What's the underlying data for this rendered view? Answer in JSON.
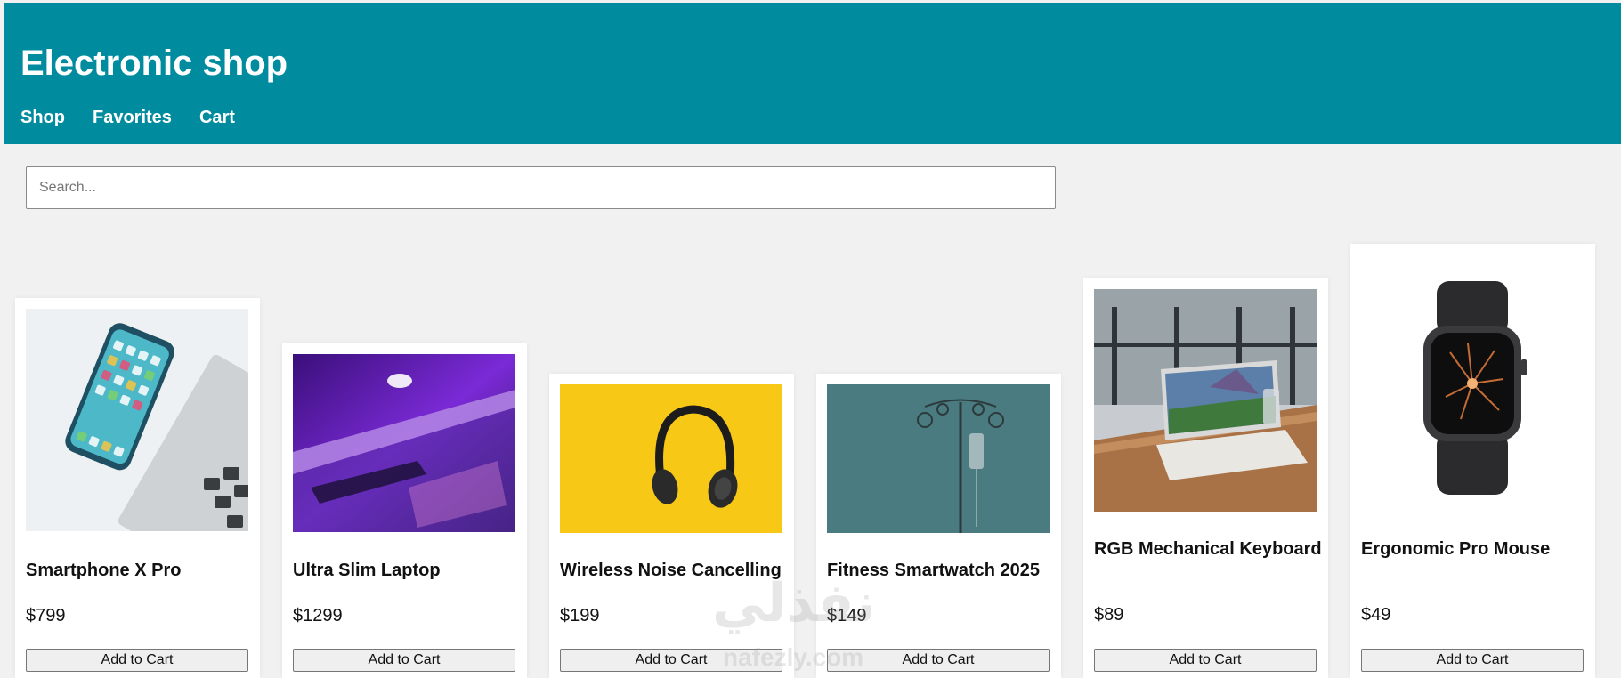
{
  "header": {
    "title": "Electronic shop",
    "nav": [
      "Shop",
      "Favorites",
      "Cart"
    ]
  },
  "search": {
    "placeholder": "Search...",
    "value": ""
  },
  "products": [
    {
      "name": "Smartphone X Pro",
      "price": "$799",
      "button": "Add to Cart",
      "image": "smartphone-photo"
    },
    {
      "name": "Ultra Slim Laptop",
      "price": "$1299",
      "button": "Add to Cart",
      "image": "laptop-photo"
    },
    {
      "name": "Wireless Noise Cancelling",
      "price": "$199",
      "button": "Add to Cart",
      "image": "headphones-photo"
    },
    {
      "name": "Fitness Smartwatch 2025",
      "price": "$149",
      "button": "Add to Cart",
      "image": "iv-stand-photo"
    },
    {
      "name": "RGB Mechanical Keyboard",
      "price": "$89",
      "button": "Add to Cart",
      "image": "laptop-desk-photo"
    },
    {
      "name": "Ergonomic Pro Mouse",
      "price": "$49",
      "button": "Add to Cart",
      "image": "smartwatch-photo"
    }
  ],
  "watermark": {
    "text": "نفذلي",
    "subtext": "nafezly.com"
  },
  "colors": {
    "header": "#008b9e",
    "background": "#f1f1f1",
    "card": "#ffffff"
  }
}
